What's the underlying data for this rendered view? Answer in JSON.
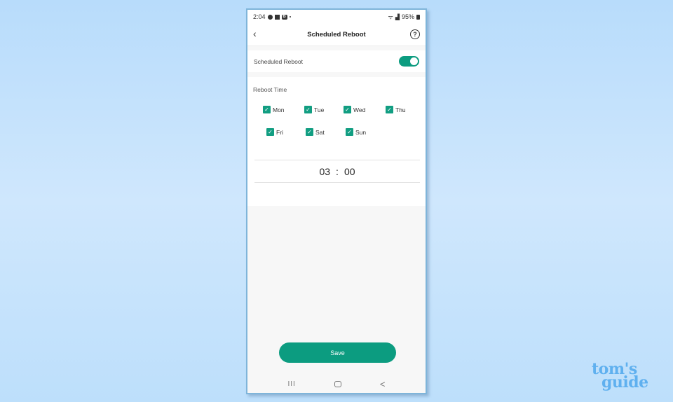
{
  "status_bar": {
    "time": "2:04",
    "battery": "95%"
  },
  "header": {
    "title": "Scheduled Reboot",
    "back_icon": "chevron-left-icon",
    "help_icon": "question-circle-icon",
    "help_glyph": "?"
  },
  "toggle": {
    "label": "Scheduled Reboot",
    "enabled": true
  },
  "reboot_time": {
    "label": "Reboot Time",
    "days": [
      {
        "label": "Mon",
        "checked": true
      },
      {
        "label": "Tue",
        "checked": true
      },
      {
        "label": "Wed",
        "checked": true
      },
      {
        "label": "Thu",
        "checked": true
      },
      {
        "label": "Fri",
        "checked": true
      },
      {
        "label": "Sat",
        "checked": true
      },
      {
        "label": "Sun",
        "checked": true
      }
    ],
    "hour": "03",
    "separator": ":",
    "minute": "00"
  },
  "save_label": "Save",
  "nav": {
    "recent": "III",
    "back": "<"
  },
  "watermark": {
    "line1": "tom's",
    "line2": "guide"
  },
  "colors": {
    "accent": "#0c9c80"
  }
}
